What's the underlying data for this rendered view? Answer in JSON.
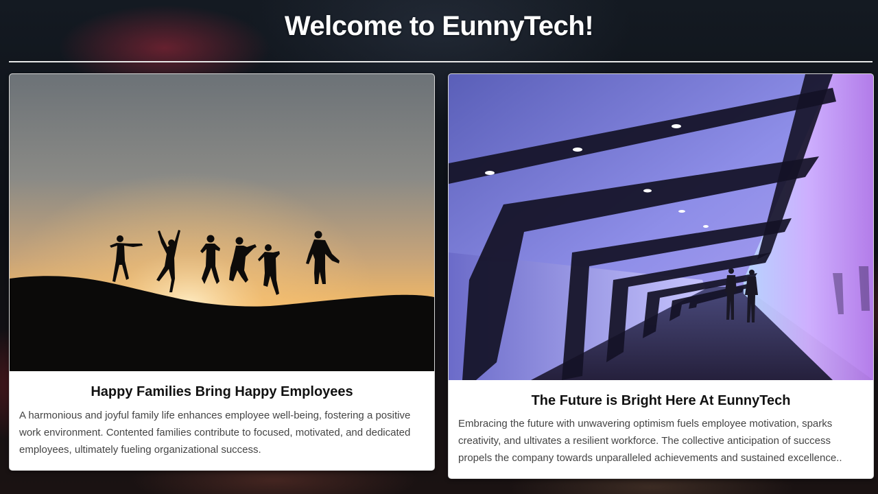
{
  "header": {
    "title": "Welcome to EunnyTech!"
  },
  "cards": [
    {
      "image": "sunset-jumping-silhouettes",
      "title": "Happy Families Bring Happy Employees",
      "text": "A harmonious and joyful family life enhances employee well-being, fostering a positive work environment. Contented families contribute to focused, motivated, and dedicated employees, ultimately fueling organizational success."
    },
    {
      "image": "neon-futuristic-corridor",
      "title": "The Future is Bright Here At EunnyTech",
      "text": "Embracing the future with unwavering optimism fuels employee motivation, sparks creativity, and ultivates a resilient workforce. The collective anticipation of success propels the company towards unparalleled achievements and sustained excellence.."
    }
  ],
  "colors": {
    "background": "#0e1118",
    "card_background": "#ffffff",
    "title_text": "#ffffff",
    "card_title": "#111111",
    "card_body": "#444444",
    "sunset_glow": "#f3b868",
    "corridor_purple": "#8d78e8"
  }
}
